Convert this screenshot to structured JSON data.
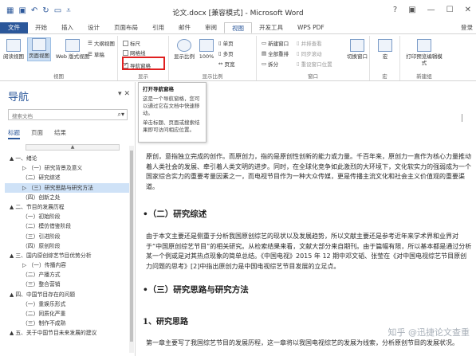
{
  "titlebar": {
    "title": "论文.docx [兼容模式] - Microsoft Word",
    "controls": [
      "?",
      "▣",
      "—",
      "☐",
      "✕"
    ]
  },
  "tabs": [
    {
      "label": "文件",
      "kind": "file"
    },
    {
      "label": "开始"
    },
    {
      "label": "插入"
    },
    {
      "label": "设计"
    },
    {
      "label": "页面布局"
    },
    {
      "label": "引用"
    },
    {
      "label": "邮件"
    },
    {
      "label": "审阅"
    },
    {
      "label": "视图",
      "kind": "active"
    },
    {
      "label": "开发工具"
    },
    {
      "label": "WPS PDF"
    }
  ],
  "login": "登录",
  "ribbon": {
    "views": {
      "label": "视图",
      "read": "阅读视图",
      "print": "页面视图",
      "web": "Web 版式视图",
      "outline": "大纲视图",
      "draft": "草稿"
    },
    "show": {
      "label": "显示",
      "ruler": "标尺",
      "gridlines": "网格线",
      "navpane": "导航窗格",
      "navpane_checked": true
    },
    "zoom": {
      "label": "显示比例",
      "zoom": "显示比例",
      "hundred": "100%",
      "one": "单页",
      "multi": "多页",
      "pagewidth": "页宽"
    },
    "window": {
      "label": "窗口",
      "newwin": "新建窗口",
      "arrange": "全部重排",
      "split": "拆分",
      "sidebyside": "并排查看",
      "sync": "同步滚动",
      "reset": "重设窗口位置",
      "switch": "切换窗口"
    },
    "macro": {
      "label": "宏",
      "macro": "宏"
    },
    "sp": {
      "label": "新建组",
      "edit": "打印预览编辑模式"
    }
  },
  "tooltip": {
    "title": "打开导航窗格",
    "p1": "这是一个导航窗格，您可以通过它在文档中快速移动。",
    "p2": "单击标题、页面或搜索结果即可访问相应位置。"
  },
  "nav": {
    "title": "导航",
    "search_placeholder": "搜索文档",
    "tabs": [
      "标题",
      "页面",
      "结果"
    ],
    "items": [
      {
        "text": "▲ 一、绪论",
        "indent": 0
      },
      {
        "text": "▷ （一）研究背景及意义",
        "indent": 1
      },
      {
        "text": "（二）研究综述",
        "indent": 1
      },
      {
        "text": "▷ （三）研究思路与研究方法",
        "indent": 1,
        "selected": true
      },
      {
        "text": "（四）创新之处",
        "indent": 1
      },
      {
        "text": "▲ 二、节目的发展历程",
        "indent": 0
      },
      {
        "text": "（一）初始阶段",
        "indent": 1
      },
      {
        "text": "（二）模仿借鉴阶段",
        "indent": 1
      },
      {
        "text": "（三）引进阶段",
        "indent": 1
      },
      {
        "text": "（四）原创阶段",
        "indent": 1
      },
      {
        "text": "▲ 三、国内原创综艺节目优势分析",
        "indent": 0
      },
      {
        "text": "▷ （一）传播内容",
        "indent": 1
      },
      {
        "text": "（二）产播方式",
        "indent": 1
      },
      {
        "text": "（三）整合营销",
        "indent": 1
      },
      {
        "text": "▲ 四、中国节目存在的问题",
        "indent": 0
      },
      {
        "text": "（一）重娱乐形式",
        "indent": 1
      },
      {
        "text": "（二）同质化严重",
        "indent": 1
      },
      {
        "text": "（三）制作不成熟",
        "indent": 1
      },
      {
        "text": "▲ 五、关于中国节目未来发展的建议",
        "indent": 0
      }
    ]
  },
  "document": {
    "p1": "原创，意指独立完成的创作。而原创力，指的是原创性创新的能力或力量。千百年来，原创力一直作为核心力量推动着人类社会的发展、牵引着人类文明的进步。同时，在全球化竞争如此激烈的大环境下，文化软实力的强弱成为一个国家综合实力的重要考量因素之一，而电视节目作为一种大众传媒，更是传播主流文化和社会主义价值观的重要渠道。",
    "h_two": "•（二）研究综述",
    "p2": "由于本文主要还是侧重于分析我国原创综艺的现状以及发展趋势，所以文献主要还是参考近年来学术界和业界对于“中国原创综艺节目”的相关研究。从检索结果来看，文献大部分来自期刊。由于篇幅有限，所以基本都是通过分析某一个例或是对其热点现象的简单总结。《中国电视》2015 年 12 期中邓文韬、张莹在《对中国电视综艺节目原创力问题的思考》[2]中指出原创力是中国电视综艺节目发展的立足点。",
    "h_three": "•（三）研究思路与研究方法",
    "h_sub": "1、研究思路",
    "p3": "第一章主要写了我国综艺节目的发展历程，这一章将以我国电视综艺的发展为线索，分析原创节目的发展状况。"
  },
  "watermark": "知乎 @迅捷论文查重"
}
